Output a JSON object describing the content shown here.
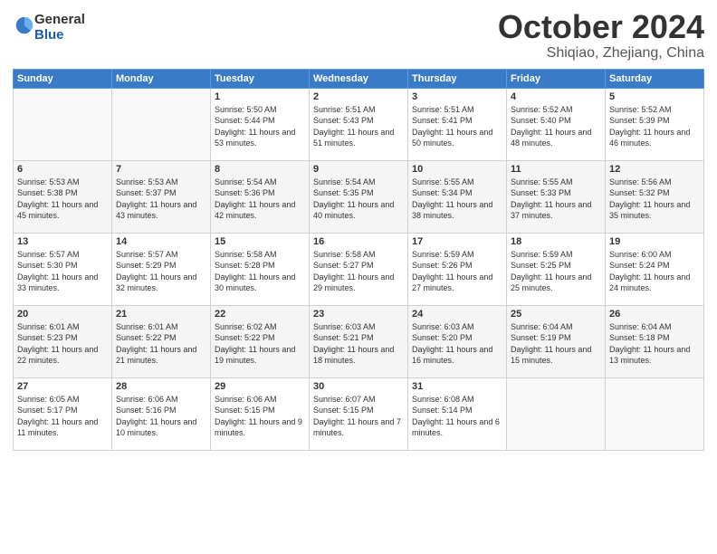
{
  "header": {
    "logo_general": "General",
    "logo_blue": "Blue",
    "month": "October 2024",
    "location": "Shiqiao, Zhejiang, China"
  },
  "weekdays": [
    "Sunday",
    "Monday",
    "Tuesday",
    "Wednesday",
    "Thursday",
    "Friday",
    "Saturday"
  ],
  "weeks": [
    [
      {
        "day": "",
        "empty": true
      },
      {
        "day": "",
        "empty": true
      },
      {
        "day": "1",
        "sunrise": "Sunrise: 5:50 AM",
        "sunset": "Sunset: 5:44 PM",
        "daylight": "Daylight: 11 hours and 53 minutes."
      },
      {
        "day": "2",
        "sunrise": "Sunrise: 5:51 AM",
        "sunset": "Sunset: 5:43 PM",
        "daylight": "Daylight: 11 hours and 51 minutes."
      },
      {
        "day": "3",
        "sunrise": "Sunrise: 5:51 AM",
        "sunset": "Sunset: 5:41 PM",
        "daylight": "Daylight: 11 hours and 50 minutes."
      },
      {
        "day": "4",
        "sunrise": "Sunrise: 5:52 AM",
        "sunset": "Sunset: 5:40 PM",
        "daylight": "Daylight: 11 hours and 48 minutes."
      },
      {
        "day": "5",
        "sunrise": "Sunrise: 5:52 AM",
        "sunset": "Sunset: 5:39 PM",
        "daylight": "Daylight: 11 hours and 46 minutes."
      }
    ],
    [
      {
        "day": "6",
        "sunrise": "Sunrise: 5:53 AM",
        "sunset": "Sunset: 5:38 PM",
        "daylight": "Daylight: 11 hours and 45 minutes."
      },
      {
        "day": "7",
        "sunrise": "Sunrise: 5:53 AM",
        "sunset": "Sunset: 5:37 PM",
        "daylight": "Daylight: 11 hours and 43 minutes."
      },
      {
        "day": "8",
        "sunrise": "Sunrise: 5:54 AM",
        "sunset": "Sunset: 5:36 PM",
        "daylight": "Daylight: 11 hours and 42 minutes."
      },
      {
        "day": "9",
        "sunrise": "Sunrise: 5:54 AM",
        "sunset": "Sunset: 5:35 PM",
        "daylight": "Daylight: 11 hours and 40 minutes."
      },
      {
        "day": "10",
        "sunrise": "Sunrise: 5:55 AM",
        "sunset": "Sunset: 5:34 PM",
        "daylight": "Daylight: 11 hours and 38 minutes."
      },
      {
        "day": "11",
        "sunrise": "Sunrise: 5:55 AM",
        "sunset": "Sunset: 5:33 PM",
        "daylight": "Daylight: 11 hours and 37 minutes."
      },
      {
        "day": "12",
        "sunrise": "Sunrise: 5:56 AM",
        "sunset": "Sunset: 5:32 PM",
        "daylight": "Daylight: 11 hours and 35 minutes."
      }
    ],
    [
      {
        "day": "13",
        "sunrise": "Sunrise: 5:57 AM",
        "sunset": "Sunset: 5:30 PM",
        "daylight": "Daylight: 11 hours and 33 minutes."
      },
      {
        "day": "14",
        "sunrise": "Sunrise: 5:57 AM",
        "sunset": "Sunset: 5:29 PM",
        "daylight": "Daylight: 11 hours and 32 minutes."
      },
      {
        "day": "15",
        "sunrise": "Sunrise: 5:58 AM",
        "sunset": "Sunset: 5:28 PM",
        "daylight": "Daylight: 11 hours and 30 minutes."
      },
      {
        "day": "16",
        "sunrise": "Sunrise: 5:58 AM",
        "sunset": "Sunset: 5:27 PM",
        "daylight": "Daylight: 11 hours and 29 minutes."
      },
      {
        "day": "17",
        "sunrise": "Sunrise: 5:59 AM",
        "sunset": "Sunset: 5:26 PM",
        "daylight": "Daylight: 11 hours and 27 minutes."
      },
      {
        "day": "18",
        "sunrise": "Sunrise: 5:59 AM",
        "sunset": "Sunset: 5:25 PM",
        "daylight": "Daylight: 11 hours and 25 minutes."
      },
      {
        "day": "19",
        "sunrise": "Sunrise: 6:00 AM",
        "sunset": "Sunset: 5:24 PM",
        "daylight": "Daylight: 11 hours and 24 minutes."
      }
    ],
    [
      {
        "day": "20",
        "sunrise": "Sunrise: 6:01 AM",
        "sunset": "Sunset: 5:23 PM",
        "daylight": "Daylight: 11 hours and 22 minutes."
      },
      {
        "day": "21",
        "sunrise": "Sunrise: 6:01 AM",
        "sunset": "Sunset: 5:22 PM",
        "daylight": "Daylight: 11 hours and 21 minutes."
      },
      {
        "day": "22",
        "sunrise": "Sunrise: 6:02 AM",
        "sunset": "Sunset: 5:22 PM",
        "daylight": "Daylight: 11 hours and 19 minutes."
      },
      {
        "day": "23",
        "sunrise": "Sunrise: 6:03 AM",
        "sunset": "Sunset: 5:21 PM",
        "daylight": "Daylight: 11 hours and 18 minutes."
      },
      {
        "day": "24",
        "sunrise": "Sunrise: 6:03 AM",
        "sunset": "Sunset: 5:20 PM",
        "daylight": "Daylight: 11 hours and 16 minutes."
      },
      {
        "day": "25",
        "sunrise": "Sunrise: 6:04 AM",
        "sunset": "Sunset: 5:19 PM",
        "daylight": "Daylight: 11 hours and 15 minutes."
      },
      {
        "day": "26",
        "sunrise": "Sunrise: 6:04 AM",
        "sunset": "Sunset: 5:18 PM",
        "daylight": "Daylight: 11 hours and 13 minutes."
      }
    ],
    [
      {
        "day": "27",
        "sunrise": "Sunrise: 6:05 AM",
        "sunset": "Sunset: 5:17 PM",
        "daylight": "Daylight: 11 hours and 11 minutes."
      },
      {
        "day": "28",
        "sunrise": "Sunrise: 6:06 AM",
        "sunset": "Sunset: 5:16 PM",
        "daylight": "Daylight: 11 hours and 10 minutes."
      },
      {
        "day": "29",
        "sunrise": "Sunrise: 6:06 AM",
        "sunset": "Sunset: 5:15 PM",
        "daylight": "Daylight: 11 hours and 9 minutes."
      },
      {
        "day": "30",
        "sunrise": "Sunrise: 6:07 AM",
        "sunset": "Sunset: 5:15 PM",
        "daylight": "Daylight: 11 hours and 7 minutes."
      },
      {
        "day": "31",
        "sunrise": "Sunrise: 6:08 AM",
        "sunset": "Sunset: 5:14 PM",
        "daylight": "Daylight: 11 hours and 6 minutes."
      },
      {
        "day": "",
        "empty": true
      },
      {
        "day": "",
        "empty": true
      }
    ]
  ]
}
